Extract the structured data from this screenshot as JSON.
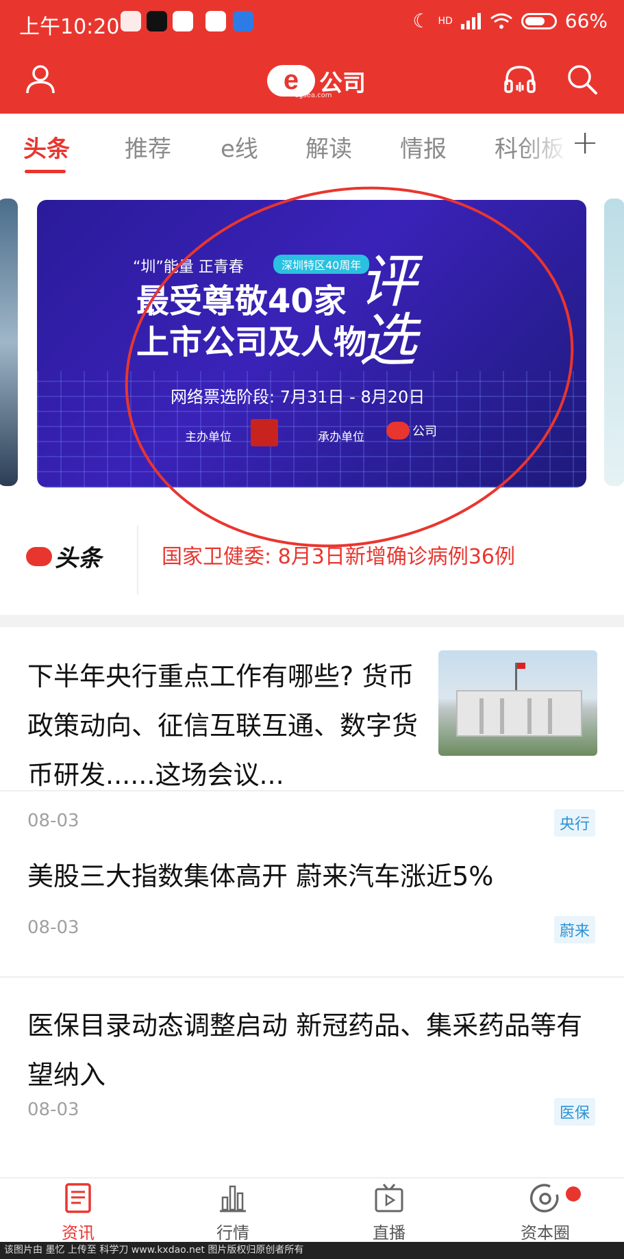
{
  "status_bar": {
    "time": "上午10:20",
    "battery": "66%",
    "network": "HD"
  },
  "app_bar": {
    "logo_text": "公司",
    "logo_sub": "egsea.com",
    "accent": "#e8362f"
  },
  "tabs": [
    {
      "label": "头条",
      "active": true
    },
    {
      "label": "推荐",
      "active": false
    },
    {
      "label": "e线",
      "active": false
    },
    {
      "label": "解读",
      "active": false
    },
    {
      "label": "情报",
      "active": false
    },
    {
      "label": "科创板",
      "active": false
    }
  ],
  "banner": {
    "kicker": "“圳”能量  正青春",
    "pill": "深圳特区40周年",
    "title_line1": "最受尊敬40家",
    "title_line2": "上市公司及人物",
    "big_text": "评选",
    "date_text": "网络票选阶段: 7月31日  - 8月20日",
    "organizer_label": "主办单位",
    "undertaker_label": "承办单位",
    "mini_logo_text": "公司"
  },
  "headline_strip": {
    "logo_text": "头条",
    "news": "国家卫健委: 8月3日新增确诊病例36例"
  },
  "news": [
    {
      "title": "下半年央行重点工作有哪些? 货币政策动向、征信互联互通、数字货币研发......这场会议...",
      "date": "08-03",
      "tag": "央行"
    },
    {
      "title": "美股三大指数集体高开 蔚来汽车涨近5%",
      "date": "08-03",
      "tag": "蔚来"
    },
    {
      "title": "医保目录动态调整启动 新冠药品、集采药品等有望纳入",
      "date": "08-03",
      "tag": "医保"
    }
  ],
  "bottom_nav": [
    {
      "label": "资讯",
      "icon": "news-icon",
      "active": true
    },
    {
      "label": "行情",
      "icon": "chart-icon",
      "active": false
    },
    {
      "label": "直播",
      "icon": "tv-icon",
      "active": false
    },
    {
      "label": "资本圈",
      "icon": "circle-icon",
      "active": false
    }
  ],
  "watermark": "该图片由 墨忆 上传至 科学刀 www.kxdao.net 图片版权归原创者所有"
}
